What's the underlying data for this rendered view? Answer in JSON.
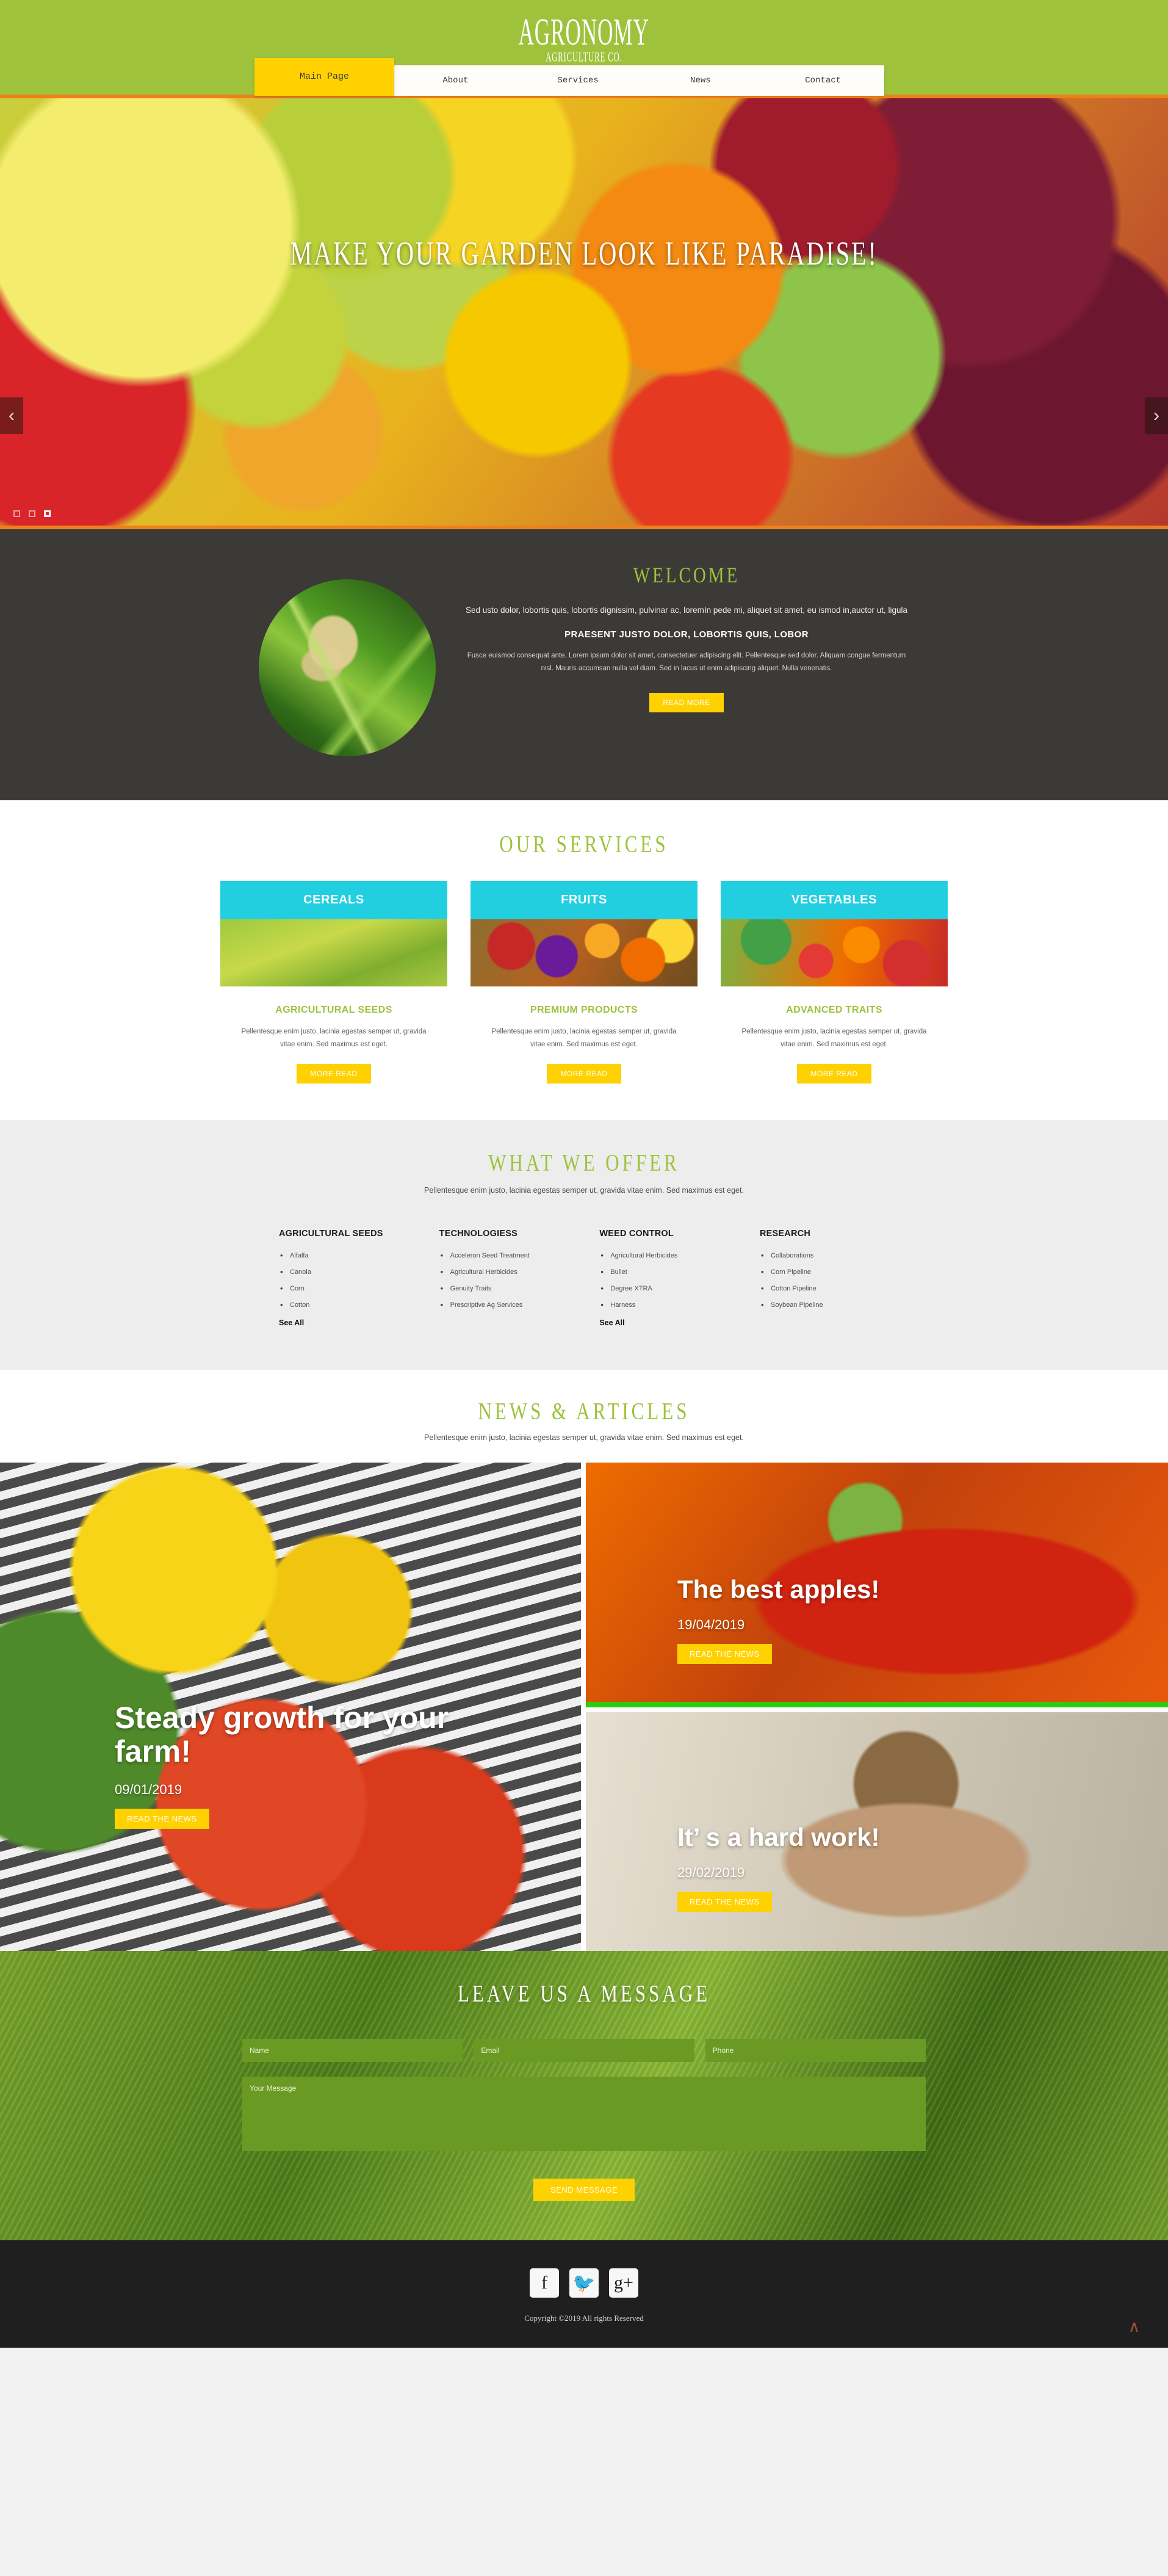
{
  "header": {
    "brand_title": "AGRONOMY",
    "brand_subtitle": "AGRICULTURE CO.",
    "nav": {
      "active": "Main Page",
      "items": [
        "About",
        "Services",
        "News",
        "Contact"
      ]
    }
  },
  "hero": {
    "title": "MAKE YOUR GARDEN LOOK LIKE PARADISE!",
    "prev_icon": "‹",
    "next_icon": "›",
    "slides": 3,
    "active_slide": 3
  },
  "welcome": {
    "heading": "WELCOME",
    "lead": "Sed usto dolor, lobortis quis, lobortis dignissim, pulvinar ac, loremIn pede mi, aliquet sit amet, eu ismod in,auctor ut, ligula",
    "subheading": "PRAESENT JUSTO DOLOR, LOBORTIS QUIS, LOBOR",
    "body": "Fusce euismod consequat ante. Lorem ipsum dolor sit amet, consectetuer adipiscing elit. Pellentesque sed dolor. Aliquam congue fermentum nisl. Mauris accumsan nulla vel diam. Sed in lacus ut enim adipiscing aliquet. Nulla venenatis.",
    "button": "READ MORE"
  },
  "services": {
    "title": "OUR SERVICES",
    "cards": [
      {
        "head": "CEREALS",
        "sub": "AGRICULTURAL SEEDS",
        "body": "Pellentesque enim justo, lacinia egestas semper ut, gravida vitae enim. Sed maximus est eget.",
        "button": "MORE READ"
      },
      {
        "head": "FRUITS",
        "sub": "PREMIUM PRODUCTS",
        "body": "Pellentesque enim justo, lacinia egestas semper ut, gravida vitae enim. Sed maximus est eget.",
        "button": "MORE READ"
      },
      {
        "head": "VEGETABLES",
        "sub": "ADVANCED TRAITS",
        "body": "Pellentesque enim justo, lacinia egestas semper ut, gravida vitae enim. Sed maximus est eget.",
        "button": "MORE READ"
      }
    ]
  },
  "offer": {
    "title": "WHAT WE OFFER",
    "lead": "Pellentesque enim justo, lacinia egestas semper ut, gravida vitae enim. Sed maximus est eget.",
    "columns": [
      {
        "heading": "AGRICULTURAL SEEDS",
        "items": [
          "Alfalfa",
          "Canola",
          "Corn",
          "Cotton"
        ],
        "see_all": "See All"
      },
      {
        "heading": "TECHNOLOGIESS",
        "items": [
          "Acceleron Seed Treatment",
          "Agricultural Herbicides",
          "Genuity Traits",
          "Prescriptive Ag Services"
        ],
        "see_all": ""
      },
      {
        "heading": "WEED CONTROL",
        "items": [
          "Agricultural Herbicides",
          "Bullet",
          "Degree XTRA",
          "Harness"
        ],
        "see_all": "See All"
      },
      {
        "heading": "RESEARCH",
        "items": [
          "Collaborations",
          "Corn Pipeline",
          "Cotton Pipeline",
          "Soybean Pipeline"
        ],
        "see_all": ""
      }
    ]
  },
  "news": {
    "title": "NEWS & ARTICLES",
    "lead": "Pellentesque enim justo, lacinia egestas semper ut, gravida vitae enim. Sed maximus est eget.",
    "cards": [
      {
        "title": "Steady growth for your farm!",
        "date": "09/01/2019",
        "button": "READ THE NEWS"
      },
      {
        "title": "The best apples!",
        "date": "19/04/2019",
        "button": "READ THE NEWS"
      },
      {
        "title": "It’ s a hard work!",
        "date": "29/02/2019",
        "button": "READ THE NEWS"
      }
    ]
  },
  "contact": {
    "title": "LEAVE US A MESSAGE",
    "name_placeholder": "Name",
    "email_placeholder": "Email",
    "phone_placeholder": "Phone",
    "message_placeholder": "Your Message",
    "send_label": "SEND MESSAGE"
  },
  "footer": {
    "socials": [
      {
        "name": "facebook",
        "glyph": "f"
      },
      {
        "name": "twitter",
        "glyph": "🐦"
      },
      {
        "name": "google-plus",
        "glyph": "g+"
      }
    ],
    "copyright": "Copyright ©2019 All rights Reserved",
    "to_top_icon": "∧"
  },
  "colors": {
    "brand_green": "#9ec23c",
    "accent_gold": "#ffd100",
    "cyan": "#22cfe0",
    "dark": "#3c3a36",
    "orange_rule": "#ef7f1a"
  }
}
